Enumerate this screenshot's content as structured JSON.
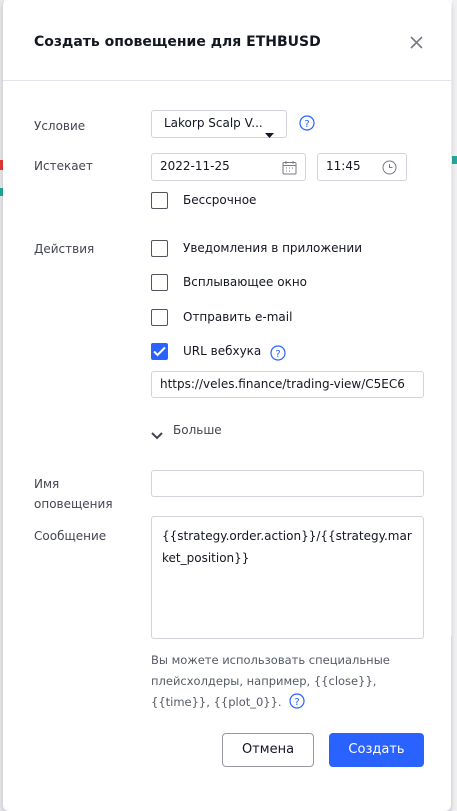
{
  "dialog": {
    "title": "Создать оповещение для ETHBUSD",
    "close_icon": "close-icon"
  },
  "condition": {
    "label": "Условие",
    "select_value": "Lakorp Scalp V...",
    "help_icon": "question-circle-icon"
  },
  "expires": {
    "label": "Истекает",
    "date": "2022-11-25",
    "time": "11:45",
    "date_icon": "calendar-icon",
    "time_icon": "clock-icon",
    "open_ended_label": "Бессрочное",
    "open_ended_checked": false
  },
  "actions": {
    "label": "Действия",
    "items": [
      {
        "label": "Уведомления в приложении",
        "checked": false
      },
      {
        "label": "Всплывающее окно",
        "checked": false
      },
      {
        "label": "Отправить e-mail",
        "checked": false
      },
      {
        "label": "URL вебхука",
        "checked": true
      }
    ],
    "webhook_help_icon": "question-circle-icon",
    "webhook_url": "https://veles.finance/trading-view/C5EC6",
    "more_label": "Больше",
    "more_icon": "chevron-down-icon"
  },
  "alert_name": {
    "label_line1": "Имя",
    "label_line2": "оповещения",
    "value": ""
  },
  "message": {
    "label": "Сообщение",
    "value": "{{strategy.order.action}}/{{strategy.market_position}}",
    "hint": "Вы можете использовать специальные плейсхолдеры, например, {{close}}, {{time}}, {{plot_0}}."
  },
  "buttons": {
    "cancel": "Отмена",
    "create": "Создать"
  },
  "colors": {
    "accent": "#2962ff",
    "text": "#131722",
    "label": "#434651",
    "border": "#d1d4dc"
  }
}
